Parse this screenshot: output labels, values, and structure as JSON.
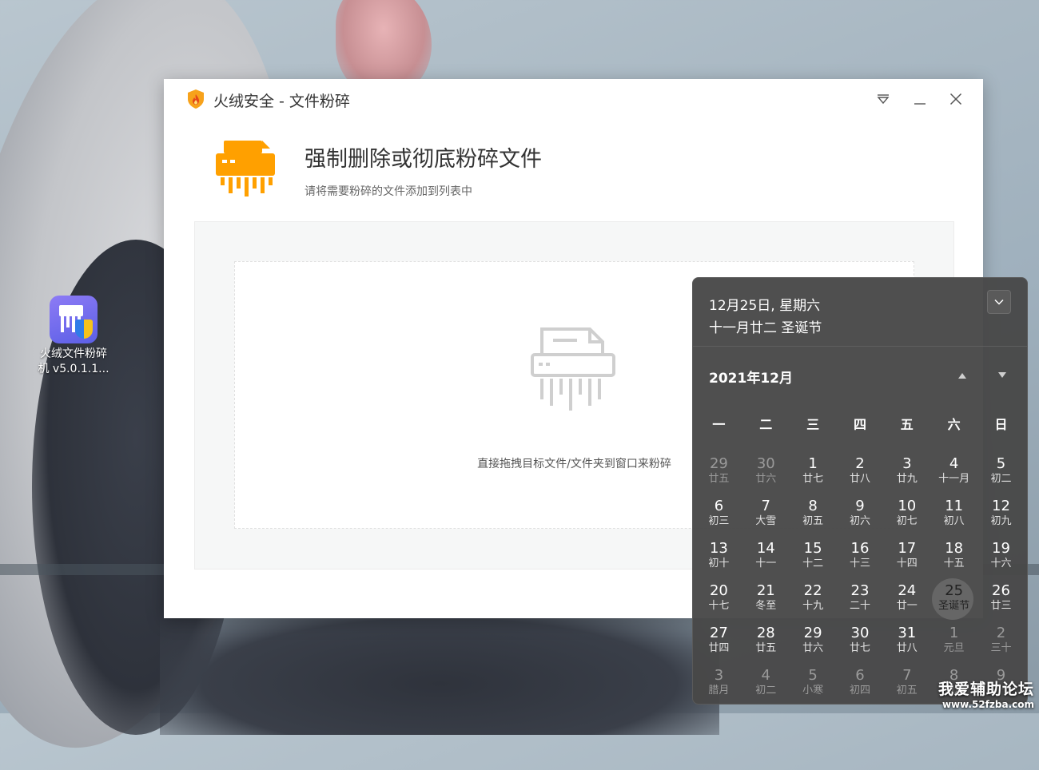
{
  "desktop": {
    "icon_label_line1": "火绒文件粉碎",
    "icon_label_line2": "机 v5.0.1.1..."
  },
  "window": {
    "title": "火绒安全 - 文件粉碎",
    "heading": "强制删除或彻底粉碎文件",
    "subheading": "请将需要粉碎的文件添加到列表中",
    "drop_hint": "直接拖拽目标文件/文件夹到窗口来粉碎",
    "accent_color": "#FFA000"
  },
  "calendar": {
    "date_line": "12月25日, 星期六",
    "lunar_line": "十一月廿二 圣诞节",
    "month_label": "2021年12月",
    "weekdays": [
      "一",
      "二",
      "三",
      "四",
      "五",
      "六",
      "日"
    ],
    "weeks": [
      [
        {
          "d": "29",
          "l": "廿五",
          "o": true
        },
        {
          "d": "30",
          "l": "廿六",
          "o": true
        },
        {
          "d": "1",
          "l": "廿七"
        },
        {
          "d": "2",
          "l": "廿八"
        },
        {
          "d": "3",
          "l": "廿九"
        },
        {
          "d": "4",
          "l": "十一月"
        },
        {
          "d": "5",
          "l": "初二"
        }
      ],
      [
        {
          "d": "6",
          "l": "初三"
        },
        {
          "d": "7",
          "l": "大雪"
        },
        {
          "d": "8",
          "l": "初五"
        },
        {
          "d": "9",
          "l": "初六"
        },
        {
          "d": "10",
          "l": "初七"
        },
        {
          "d": "11",
          "l": "初八"
        },
        {
          "d": "12",
          "l": "初九"
        }
      ],
      [
        {
          "d": "13",
          "l": "初十"
        },
        {
          "d": "14",
          "l": "十一"
        },
        {
          "d": "15",
          "l": "十二"
        },
        {
          "d": "16",
          "l": "十三"
        },
        {
          "d": "17",
          "l": "十四"
        },
        {
          "d": "18",
          "l": "十五"
        },
        {
          "d": "19",
          "l": "十六"
        }
      ],
      [
        {
          "d": "20",
          "l": "十七"
        },
        {
          "d": "21",
          "l": "冬至"
        },
        {
          "d": "22",
          "l": "十九"
        },
        {
          "d": "23",
          "l": "二十"
        },
        {
          "d": "24",
          "l": "廿一"
        },
        {
          "d": "25",
          "l": "圣诞节",
          "t": true
        },
        {
          "d": "26",
          "l": "廿三"
        }
      ],
      [
        {
          "d": "27",
          "l": "廿四"
        },
        {
          "d": "28",
          "l": "廿五"
        },
        {
          "d": "29",
          "l": "廿六"
        },
        {
          "d": "30",
          "l": "廿七"
        },
        {
          "d": "31",
          "l": "廿八"
        },
        {
          "d": "1",
          "l": "元旦",
          "o": true
        },
        {
          "d": "2",
          "l": "三十",
          "o": true
        }
      ],
      [
        {
          "d": "3",
          "l": "腊月",
          "o": true
        },
        {
          "d": "4",
          "l": "初二",
          "o": true
        },
        {
          "d": "5",
          "l": "小寒",
          "o": true
        },
        {
          "d": "6",
          "l": "初四",
          "o": true
        },
        {
          "d": "7",
          "l": "初五",
          "o": true
        },
        {
          "d": "8",
          "l": "初六",
          "o": true
        },
        {
          "d": "9",
          "l": "初七",
          "o": true
        }
      ]
    ]
  },
  "watermark": {
    "line1": "我爱辅助论坛",
    "line2": "www.52fzba.com"
  }
}
